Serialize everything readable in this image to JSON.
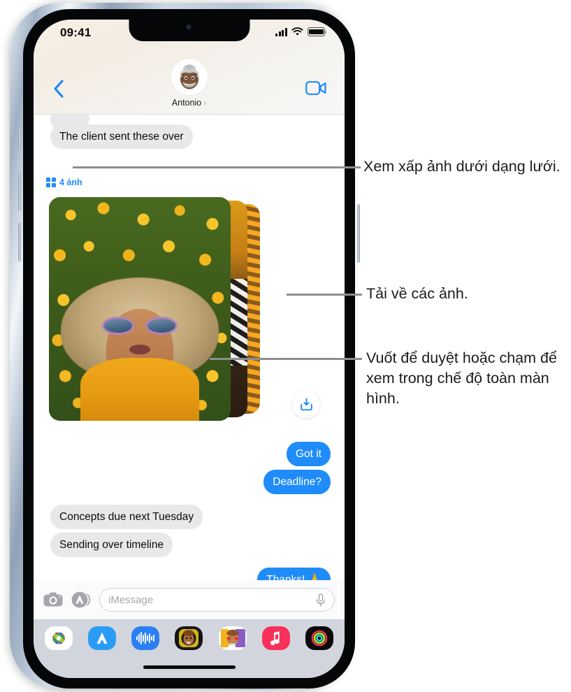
{
  "status_bar": {
    "time": "09:41",
    "cellular_icon": "signal-bars-icon",
    "wifi_icon": "wifi-icon",
    "battery_icon": "battery-icon"
  },
  "header": {
    "back_icon": "back-chevron-icon",
    "facetime_icon": "video-camera-icon",
    "contact_name": "Antonio",
    "contact_chevron": "›",
    "avatar_icon": "memoji-avatar"
  },
  "thread": {
    "partial_label": "",
    "messages": [
      {
        "text": "The client sent these over",
        "side": "in"
      },
      {
        "text": "Got it",
        "side": "out"
      },
      {
        "text": "Deadline?",
        "side": "out"
      },
      {
        "text": "Concepts due next Tuesday",
        "side": "in"
      },
      {
        "text": "Sending over timeline",
        "side": "in"
      },
      {
        "text": "Thanks! 🙏",
        "side": "out"
      }
    ],
    "grid_affordance": {
      "icon": "grid-2x2-icon",
      "label": "4 ảnh"
    },
    "download_button": {
      "icon": "download-tray-icon"
    }
  },
  "input_bar": {
    "camera_icon": "camera-icon",
    "apps_icon": "app-store-icon",
    "placeholder": "iMessage",
    "mic_icon": "microphone-icon"
  },
  "app_drawer": {
    "items": [
      {
        "name": "photos-app-icon"
      },
      {
        "name": "app-store-app-icon"
      },
      {
        "name": "audio-message-app-icon"
      },
      {
        "name": "memoji-app-icon"
      },
      {
        "name": "memoji-stickers-app-icon"
      },
      {
        "name": "music-app-icon"
      },
      {
        "name": "fitness-app-icon"
      }
    ]
  },
  "callouts": [
    {
      "text": "Xem xấp ảnh dưới dạng lưới."
    },
    {
      "text": "Tải về các ảnh."
    },
    {
      "text": "Vuốt để duyệt hoặc chạm để xem trong chế độ toàn màn hình."
    }
  ],
  "colors": {
    "imessage_blue": "#1f8cf9",
    "bubble_gray": "#e8e8ea",
    "accent_blue": "#1f8cf9",
    "leader_gray": "#8e8e8e"
  }
}
